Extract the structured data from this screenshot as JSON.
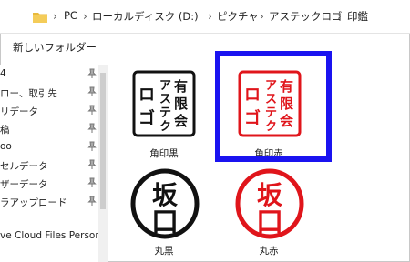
{
  "address": {
    "breadcrumbs": [
      "PC",
      "ローカルディスク (D:)",
      "ピクチャ",
      "アステックロゴ",
      "印鑑"
    ]
  },
  "toolbar": {
    "new_folder_label": "新しいフォルダー"
  },
  "nav": {
    "items": [
      {
        "label": "4"
      },
      {
        "label": "ロー、取引先"
      },
      {
        "label": "リデータ"
      },
      {
        "label": "稿"
      },
      {
        "label": "oo"
      },
      {
        "label": "セルデータ"
      },
      {
        "label": "ザーデータ"
      },
      {
        "label": "ラアップロード"
      },
      {
        "label": "ve Cloud Files Persona"
      }
    ]
  },
  "files": [
    {
      "caption": "角印黒",
      "stamp_text": [
        "有限会社",
        "アステック",
        "ロゴ"
      ],
      "color": "#111111"
    },
    {
      "caption": "角印赤",
      "stamp_text": [
        "有限会社",
        "アステック",
        "ロゴ"
      ],
      "color": "#e0151b"
    },
    {
      "caption": "丸黒",
      "stamp_text": [
        "坂",
        "口"
      ],
      "color": "#111111"
    },
    {
      "caption": "丸赤",
      "stamp_text": [
        "坂",
        "口"
      ],
      "color": "#e0151b"
    }
  ],
  "colors": {
    "highlight": "#1a13f0",
    "stamp_red": "#e0151b",
    "stamp_black": "#111111"
  }
}
